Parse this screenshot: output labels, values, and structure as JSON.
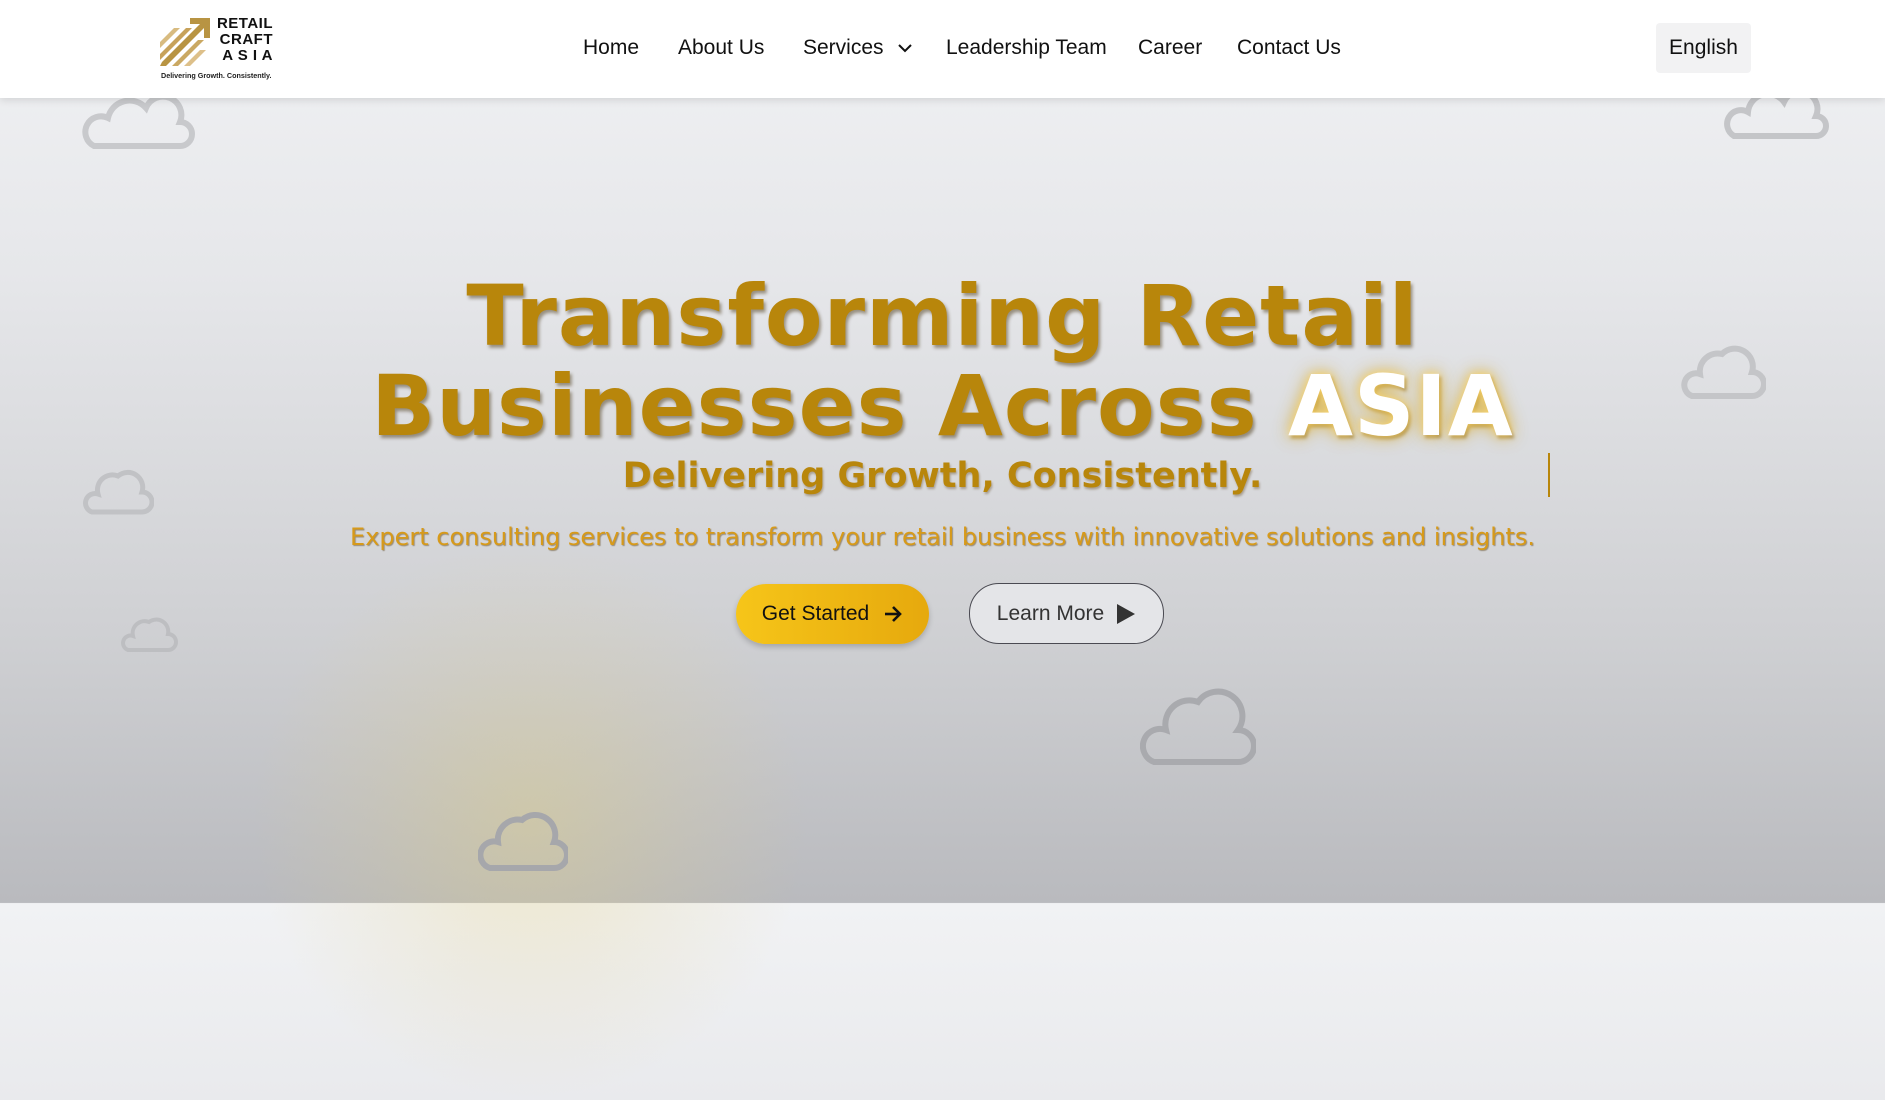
{
  "brand": {
    "line1": "RETAIL",
    "line2": "CRAFT",
    "line3": "A S I A",
    "tagline": "Delivering Growth. Consistently."
  },
  "nav": {
    "items": [
      {
        "label": "Home"
      },
      {
        "label": "About Us"
      },
      {
        "label": "Services"
      },
      {
        "label": "Leadership Team"
      },
      {
        "label": "Career"
      },
      {
        "label": "Contact Us"
      }
    ],
    "language": "English"
  },
  "hero": {
    "title_line1": "Transforming Retail",
    "title_line2": "Businesses Across",
    "title_highlight": "ASIA",
    "subtitle": "Delivering Growth, Consistently.",
    "description": "Expert consulting services to transform your retail business with innovative solutions and insights.",
    "primary_button": "Get Started",
    "secondary_button": "Learn More"
  },
  "colors": {
    "gold": "#b8860b",
    "button_gold": "#f6c519",
    "background": "#e6e7ea"
  }
}
